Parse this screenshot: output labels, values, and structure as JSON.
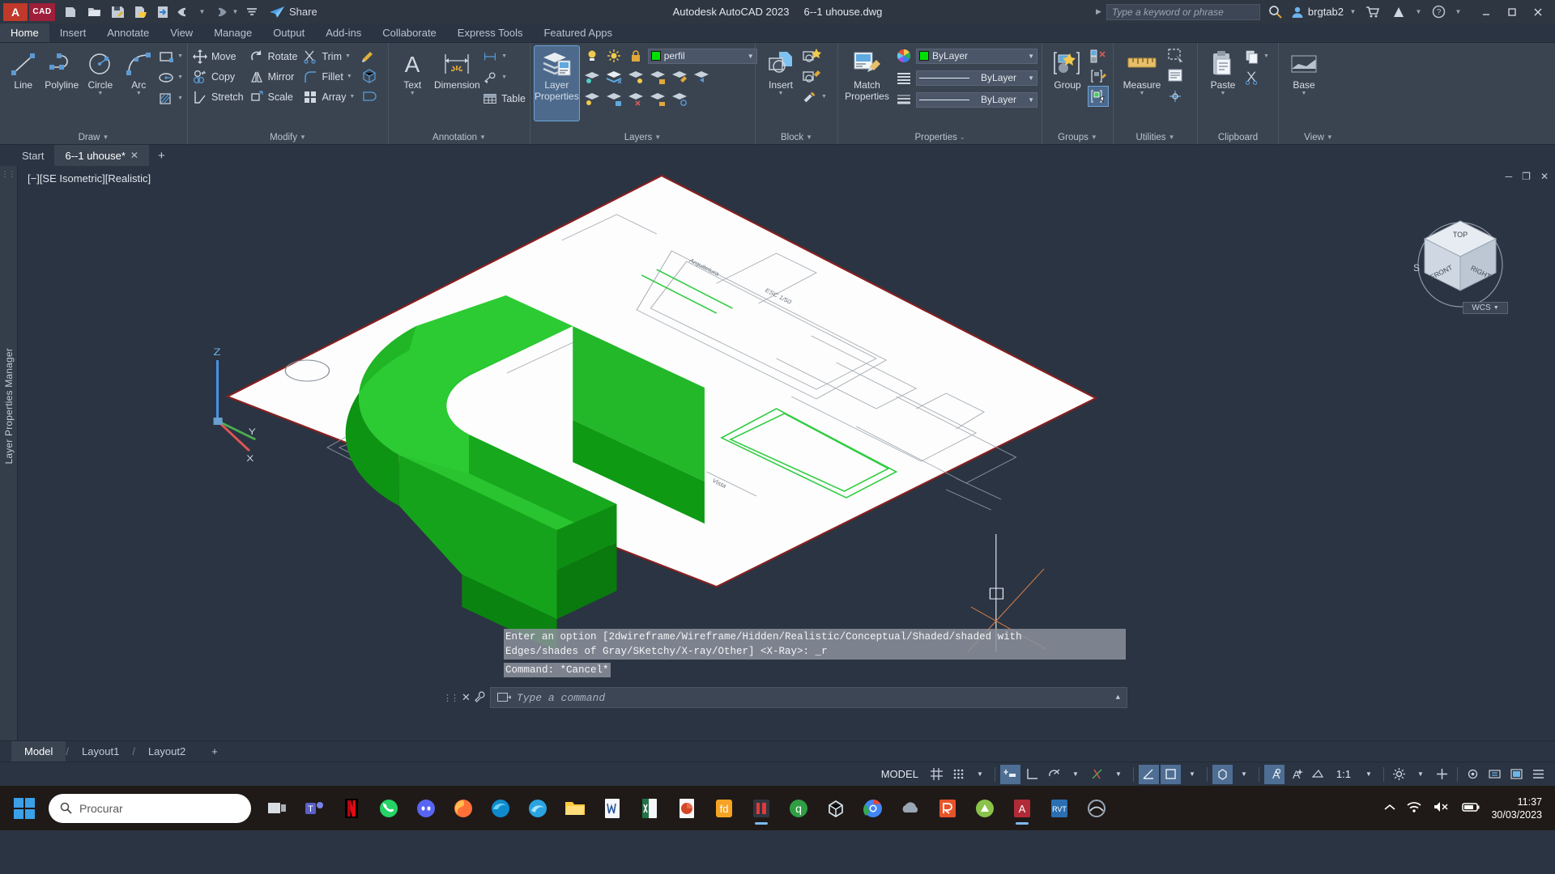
{
  "titlebar": {
    "logo": "A",
    "cad_badge": "CAD",
    "share_label": "Share",
    "app_title": "Autodesk AutoCAD 2023",
    "document_title": "6--1 uhouse.dwg",
    "search_placeholder": "Type a keyword or phrase",
    "user_name": "brgtab2",
    "quick_access": [
      {
        "name": "new-file-icon",
        "tip": "New"
      },
      {
        "name": "open-file-icon",
        "tip": "Open"
      },
      {
        "name": "save-icon",
        "tip": "Save"
      },
      {
        "name": "save-as-icon",
        "tip": "Save As"
      },
      {
        "name": "plot-icon",
        "tip": "Plot"
      },
      {
        "name": "undo-icon",
        "tip": "Undo"
      },
      {
        "name": "redo-icon",
        "tip": "Redo"
      },
      {
        "name": "qat-customize-icon",
        "tip": "Customize"
      }
    ],
    "window_buttons": [
      "minimize",
      "restore",
      "close"
    ]
  },
  "ribbon": {
    "tabs": [
      {
        "label": "Home",
        "active": true
      },
      {
        "label": "Insert",
        "active": false
      },
      {
        "label": "Annotate",
        "active": false
      },
      {
        "label": "View",
        "active": false
      },
      {
        "label": "Manage",
        "active": false
      },
      {
        "label": "Output",
        "active": false
      },
      {
        "label": "Add-ins",
        "active": false
      },
      {
        "label": "Collaborate",
        "active": false
      },
      {
        "label": "Express Tools",
        "active": false
      },
      {
        "label": "Featured Apps",
        "active": false
      }
    ],
    "draw": {
      "title": "Draw",
      "line": "Line",
      "polyline": "Polyline",
      "circle": "Circle",
      "arc": "Arc"
    },
    "modify": {
      "title": "Modify",
      "move": "Move",
      "rotate": "Rotate",
      "trim": "Trim",
      "copy": "Copy",
      "mirror": "Mirror",
      "fillet": "Fillet",
      "stretch": "Stretch",
      "scale": "Scale",
      "array": "Array"
    },
    "annotation": {
      "title": "Annotation",
      "text": "Text",
      "dimension": "Dimension",
      "table": "Table"
    },
    "layers": {
      "title": "Layers",
      "layer_properties": "Layer\nProperties",
      "layer_properties_l1": "Layer",
      "layer_properties_l2": "Properties",
      "current_layer": "perfil",
      "layer_color": "#00e000"
    },
    "block": {
      "title": "Block",
      "insert": "Insert"
    },
    "properties": {
      "title": "Properties",
      "match_properties_l1": "Match",
      "match_properties_l2": "Properties",
      "color": "ByLayer",
      "linetype": "ByLayer",
      "lineweight": "ByLayer",
      "color_swatch": "#00e000"
    },
    "groups": {
      "title": "Groups",
      "group": "Group"
    },
    "utilities": {
      "title": "Utilities",
      "measure": "Measure"
    },
    "clipboard": {
      "title": "Clipboard",
      "paste": "Paste"
    },
    "view": {
      "title": "View",
      "base": "Base"
    }
  },
  "file_tabs": [
    {
      "label": "Start",
      "active": false,
      "closable": false
    },
    {
      "label": "6--1 uhouse*",
      "active": true,
      "closable": true
    }
  ],
  "file_tabs_add": "+",
  "workspace": {
    "left_dock_label": "Layer Properties Manager",
    "viewport_label": "[−][SE Isometric][Realistic]",
    "viewcube": {
      "top": "TOP",
      "front": "FRONT",
      "right": "RIGHT",
      "compass_s": "S"
    },
    "wcs_label": "WCS",
    "ucs_axes": {
      "z": "Z",
      "y": "Y",
      "x": "X"
    }
  },
  "command": {
    "history_line_1": "Enter an option [2dwireframe/Wireframe/Hidden/Realistic/Conceptual/Shaded/shaded with",
    "history_line_2": "Edges/shades of Gray/SKetchy/X-ray/Other] <X-Ray>: _r",
    "history_line_3": "Command: *Cancel*",
    "input_placeholder": "Type a command"
  },
  "layout_tabs": [
    {
      "label": "Model",
      "active": true
    },
    {
      "label": "Layout1",
      "active": false
    },
    {
      "label": "Layout2",
      "active": false
    }
  ],
  "layout_tabs_add": "+",
  "statusbar": {
    "model_label": "MODEL",
    "scale": "1:1",
    "toggles": [
      {
        "name": "grid-display-toggle",
        "icon": "grid",
        "on": false
      },
      {
        "name": "snap-mode-toggle",
        "icon": "snap",
        "on": false
      },
      {
        "name": "infer-constraints-toggle",
        "icon": "infer",
        "on": true
      },
      {
        "name": "ortho-mode-toggle",
        "icon": "ortho",
        "on": false
      },
      {
        "name": "polar-tracking-toggle",
        "icon": "polar",
        "on": false
      },
      {
        "name": "osnap-toggle",
        "icon": "osnap",
        "on": false
      },
      {
        "name": "otrack-toggle",
        "icon": "otrack",
        "on": true
      },
      {
        "name": "lineweight-toggle",
        "icon": "lineweight",
        "on": true
      },
      {
        "name": "transparency-toggle",
        "icon": "transparency",
        "on": false
      },
      {
        "name": "selection-cycling-toggle",
        "icon": "cycling",
        "on": true
      },
      {
        "name": "annotation-visibility-toggle",
        "icon": "annovis",
        "on": false
      }
    ]
  },
  "taskbar": {
    "search_placeholder": "Procurar",
    "clock_time": "11:37",
    "clock_date": "30/03/2023",
    "apps": [
      {
        "name": "taskview-icon",
        "color": "#cfcfcf"
      },
      {
        "name": "teams-icon",
        "color": "#6264a7"
      },
      {
        "name": "netflix-icon",
        "color": "#e50914"
      },
      {
        "name": "whatsapp-icon",
        "color": "#25d366"
      },
      {
        "name": "discord-icon",
        "color": "#5865f2"
      },
      {
        "name": "firefox-icon",
        "color": "#ff7139"
      },
      {
        "name": "edge-icon",
        "color": "#0f8bcd"
      },
      {
        "name": "edge-beta-icon",
        "color": "#2aa3e0"
      },
      {
        "name": "file-explorer-icon",
        "color": "#ffc83d"
      },
      {
        "name": "word-icon",
        "color": "#2b579a"
      },
      {
        "name": "excel-icon",
        "color": "#217346"
      },
      {
        "name": "powerpoint-icon",
        "color": "#d24726"
      },
      {
        "name": "freedownload-icon",
        "color": "#f6a323"
      },
      {
        "name": "recorder-icon",
        "color": "#e03a3a"
      },
      {
        "name": "qbittorrent-icon",
        "color": "#2f9e44"
      },
      {
        "name": "sketchup-icon",
        "color": "#d6e2ea"
      },
      {
        "name": "chrome-icon",
        "color": "#4285f4"
      },
      {
        "name": "cloud-icon",
        "color": "#8e9aa6"
      },
      {
        "name": "revit-icon",
        "color": "#e8542a"
      },
      {
        "name": "lumion-icon",
        "color": "#8bc34a"
      },
      {
        "name": "autocad-icon",
        "color": "#c0392b",
        "active": true
      },
      {
        "name": "revit-rvt-icon",
        "color": "#2b6fb2"
      },
      {
        "name": "navisworks-icon",
        "color": "#7d8b99"
      }
    ]
  }
}
